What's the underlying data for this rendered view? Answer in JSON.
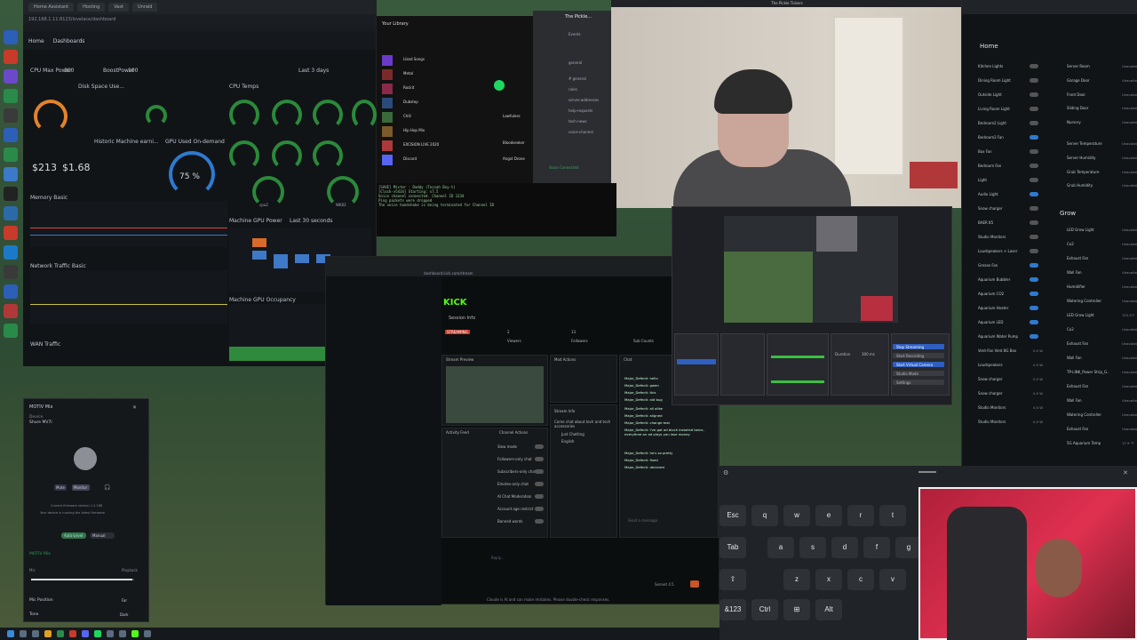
{
  "colors": {
    "kick_green": "#53fc18",
    "ha_blue": "#2f7ad0",
    "gauge_green": "#2a8a3a",
    "gauge_orange": "#e3832b",
    "danger_red": "#e04040"
  },
  "ha_dashboard": {
    "breadcrumb_home": "Home",
    "breadcrumb_dashboards": "Dashboards",
    "cpu_max_power_label": "CPU Max Power",
    "cpu_max_power_value": "300",
    "boost_power_label": "BoostPower",
    "boost_power_value": "100",
    "range": "Last 3 days",
    "cards": {
      "disk_space": "Disk Space Use...",
      "cpu_temps": "CPU Temps",
      "historic_machine": "Historic Machine earni...",
      "gpu_used": "GPU Used On-demand",
      "memory_basic": "Memory Basic",
      "network_traffic": "Network Traffic Basic",
      "wan_traffic": "WAN Traffic",
      "machine_gpu_power": "Machine GPU Power",
      "machine_gpu_occupancy": "Machine GPU Occupancy",
      "last_30_seconds": "Last 30 seconds"
    },
    "money_1": "$213",
    "money_2": "$1.68",
    "gpu_percent": "75 %",
    "gauges": [
      "WK00",
      "WK01",
      "cpu1",
      "cpu2",
      "WK02",
      "WK03",
      "WK04"
    ]
  },
  "spotify": {
    "title": "Your Library",
    "items": [
      "Liked Songs",
      "Metal",
      "Rockit",
      "Dubstep",
      "Chill",
      "Hip Hop Mix",
      "EXCISION LIVE 2020",
      "Discord"
    ],
    "tracks": [
      "Lawfuless",
      "Bloodseeker",
      "Angst Drone"
    ]
  },
  "discord": {
    "server": "The Pickle...",
    "channels": [
      "Events",
      "general",
      "# general",
      "rules",
      "server-addresses",
      "help-requests",
      "tech-news",
      "voice-channel"
    ],
    "voice": "Voice Connected"
  },
  "webcam": {
    "window_title": "The Pickle Tickers"
  },
  "terminal": {
    "lines": [
      "[SAVE] Mister - Daddy (Tessah Boy-t)",
      "[Clock->5434] Starting: x7.5",
      "Voice channel connected. Channel ID 1234",
      "Ping packets were dropped",
      "The voice handshake is being terminated for Channel ID"
    ]
  },
  "kick": {
    "url": "dashboard.kick.com/stream",
    "logo": "KICK",
    "session_info": "Session Info",
    "streaming_badge": "STREAMING",
    "viewers_label": "Viewers",
    "viewers_value": "2",
    "followers_label": "Followers",
    "followers_value": "13",
    "sub_counts_label": "Sub Counts",
    "stream_preview": "Stream Preview",
    "mod_actions": "Mod Actions",
    "chat": "Chat",
    "stream_info": "Stream Info",
    "stream_title": "Come chat about tech and tech accessories",
    "category": "Just Chatting",
    "language": "English",
    "activity_feed": "Activity Feed",
    "channel_actions": "Channel Actions",
    "toggles": [
      {
        "label": "Slow mode",
        "on": false
      },
      {
        "label": "Followers-only chat",
        "on": false
      },
      {
        "label": "Subscribers-only chat",
        "on": false
      },
      {
        "label": "Emotes-only chat",
        "on": false
      },
      {
        "label": "AI Chat Moderation",
        "on": false
      },
      {
        "label": "Account age restrict",
        "on": false
      },
      {
        "label": "Banned words",
        "on": false
      }
    ],
    "chat_messages": [
      "Major_Defecti: hello",
      "Major_Defecti: gwen",
      "Major_Defecti: this",
      "Major_Defecti: old bug",
      "Major_Defecti: all alike",
      "Major_Defecti: aligned",
      "Major_Defecti: change test",
      "Major_Defecti: I've got ad block installed twice, everytime an ad plays you lose money",
      "Major_Defecti: he's so pretty",
      "Major_Defecti: fixed",
      "Major_Defecti: declared"
    ],
    "send_placeholder": "Send a message"
  },
  "obs": {
    "scenes": "Scenes",
    "sources": "Sources",
    "audio_mixer": "Audio Mixer",
    "scene_transitions": "Scene Transitions",
    "controls": "Controls",
    "start_streaming": "Stop Streaming",
    "start_recording": "Start Recording",
    "virtual_camera": "Start Virtual Camera",
    "studio_mode": "Studio Mode",
    "settings": "Settings",
    "duration_label": "Duration",
    "duration_value": "300 ms"
  },
  "ha_right": {
    "home": "Home",
    "grow": "Grow",
    "left_rows": [
      "Kitchen Lights",
      "Dining Room Light",
      "Outside Light",
      "Living Room Light",
      "Bedroom2 Light",
      "Bedroom2 Fan",
      "Box Fan",
      "Bedroom Fan",
      "Light",
      "Audio Light",
      "Snow charger",
      "BAER 85",
      "Studio Monitors",
      "Loudspeakers + Laser",
      "Grease Fan",
      "Aquarium Bubbler",
      "Aquarium CO2",
      "Aquarium Heater",
      "Aquarium LED",
      "Aquarium Water Pump",
      "Vent-Fan Vent 8G Box",
      "Loudspeakers",
      "Snow charger",
      "Snow charger",
      "Studio Monitors",
      "Studio Monitors"
    ],
    "left_values": [
      "0.0 W",
      "0.0 W",
      "0.0 W",
      "0.0 W",
      "0.0 W",
      "0.0 W"
    ],
    "right_rows": [
      "Server Room",
      "Garage Door",
      "Front Door",
      "Sliding Door",
      "Nursery",
      "Server Temperature",
      "Server Humidity",
      "Grub Temperature",
      "Grub Humidity"
    ],
    "right_values": [
      "Unavailable",
      "Unavailable",
      "Unavailable",
      "Unavailable",
      "Unavailable",
      "Unavailable",
      "Unavailable",
      "Unavailable",
      "Unavailable"
    ],
    "grow_rows": [
      "LED Grow Light",
      "Co2",
      "Exhaust Fan",
      "Wall Fan",
      "Humidifier",
      "Watering Controller",
      "LED Grow Light",
      "Co2",
      "Exhaust Fan",
      "Wall Fan",
      "TP-LINK_Power Strip_G..",
      "Exhaust Fan",
      "Wall Fan",
      "Watering Controller",
      "Exhaust Fan",
      "5G Aquarium Temp"
    ],
    "grow_values": [
      "Unavailable",
      "Unavailable",
      "Unavailable",
      "Unavailable",
      "Unavailable",
      "Unavailable",
      "122.0 F",
      "Unavailable",
      "Unavailable",
      "Unavailable",
      "Unavailable",
      "Unavailable",
      "Unavailable",
      "Unavailable",
      "Unavailable",
      "17.9 °F"
    ]
  },
  "motiv": {
    "title": "MOTIV Mix",
    "device_label": "Device",
    "device": "Shure MV7i",
    "mute_btn": "Mute",
    "monitor_btn": "Monitor",
    "firmware": "Current firmware version 1.2.186",
    "note": "Your device is running the latest firmware",
    "tab_internal": "Auto-Level",
    "tab_manual": "Manual",
    "section": "MOTIV Mix",
    "mic_label": "Mic",
    "playback_label": "Playback",
    "mic_position": "Mic Position",
    "tone_label": "Tone",
    "near_label": "Near",
    "far_label": "Far",
    "dark_label": "Dark",
    "slider_value": 0.98
  },
  "keyboard": {
    "row1": [
      "Esc",
      "q",
      "w",
      "e",
      "r",
      "t"
    ],
    "row2": [
      "Tab",
      "a",
      "s",
      "d",
      "f",
      "g"
    ],
    "row3": [
      "⇧",
      "z",
      "x",
      "c",
      "v"
    ],
    "row4": [
      "&123",
      "Ctrl",
      "⊞",
      "Alt"
    ]
  },
  "footer": {
    "text": "Claude is AI and can make mistakes. Please double-check responses.",
    "model": "Sonnet 4.5",
    "placeholder": "Reply..."
  }
}
